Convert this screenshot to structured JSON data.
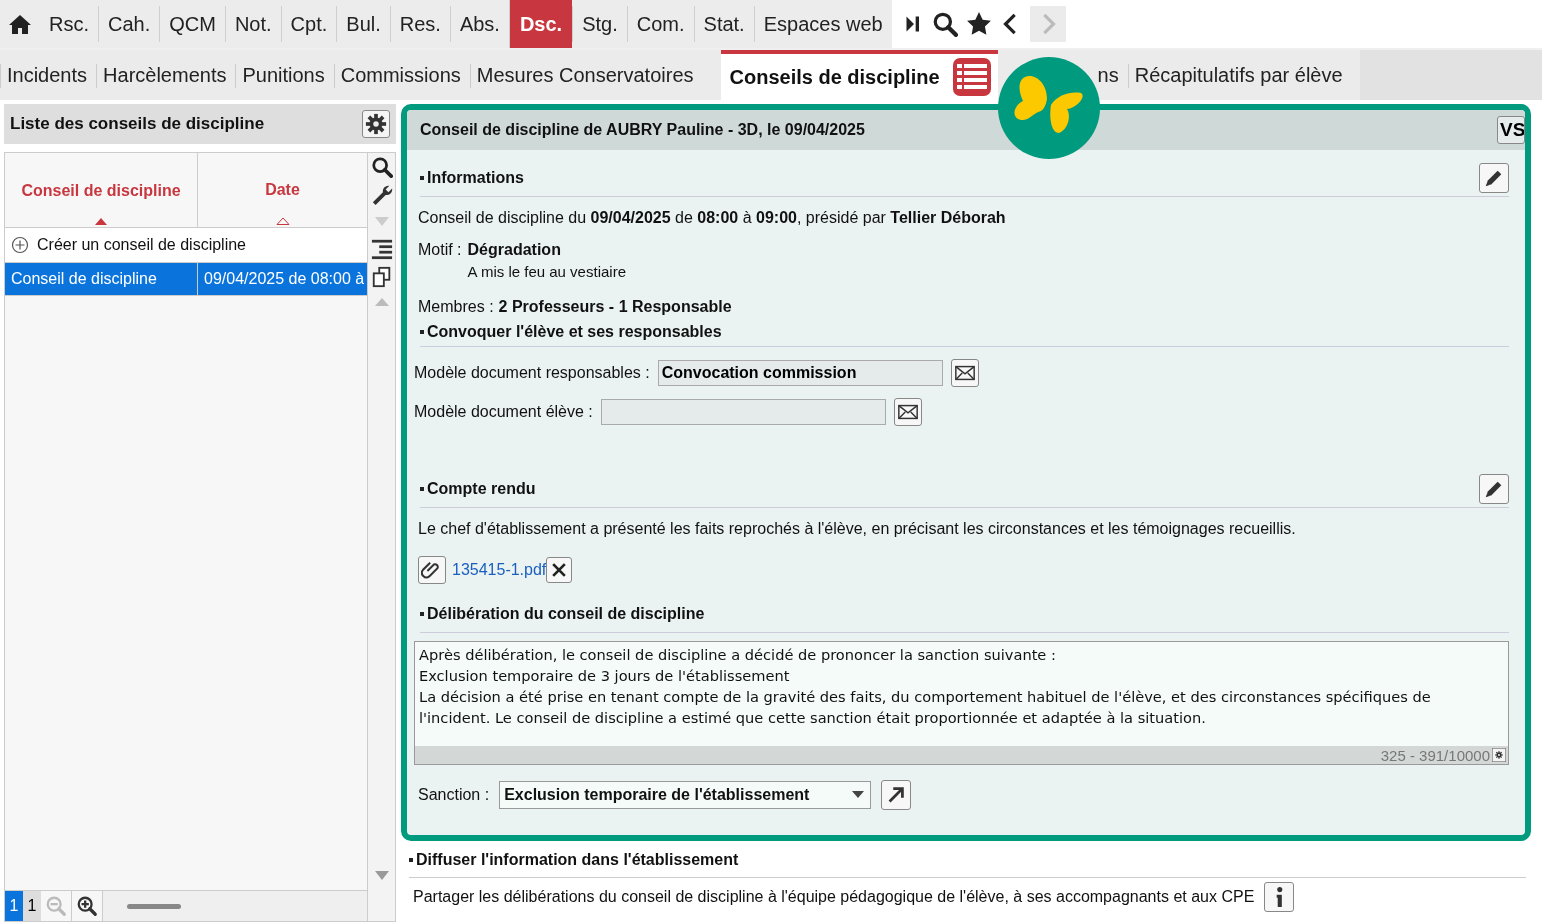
{
  "topnav": {
    "items": [
      {
        "label": "Rsc.",
        "selected": false
      },
      {
        "label": "Cah.",
        "selected": false
      },
      {
        "label": "QCM",
        "selected": false
      },
      {
        "label": "Not.",
        "selected": false
      },
      {
        "label": "Cpt.",
        "selected": false
      },
      {
        "label": "Bul.",
        "selected": false
      },
      {
        "label": "Res.",
        "selected": false
      },
      {
        "label": "Abs.",
        "selected": false
      },
      {
        "label": "Dsc.",
        "selected": true
      },
      {
        "label": "Stg.",
        "selected": false
      },
      {
        "label": "Com.",
        "selected": false
      },
      {
        "label": "Stat.",
        "selected": false
      },
      {
        "label": "Espaces web",
        "selected": false
      }
    ]
  },
  "subtabs": {
    "items": [
      {
        "label": "Incidents",
        "selected": false
      },
      {
        "label": "Harcèlements",
        "selected": false
      },
      {
        "label": "Punitions",
        "selected": false
      },
      {
        "label": "Commissions",
        "selected": false
      },
      {
        "label": "Mesures Conservatoires",
        "selected": false
      },
      {
        "label": "Conseils de discipline",
        "selected": true
      },
      {
        "label": "ns",
        "selected": false
      },
      {
        "label": "Récapitulatifs par élève",
        "selected": false
      }
    ]
  },
  "list": {
    "title": "Liste des conseils de discipline",
    "columns": [
      {
        "label": "Conseil de discipline",
        "sorted": true
      },
      {
        "label": "Date",
        "sorted": false
      }
    ],
    "create_label": "Créer un conseil de discipline",
    "rows": [
      {
        "cells": [
          "Conseil de discipline",
          "09/04/2025 de 08:00 à"
        ],
        "selected": true
      }
    ],
    "pager": [
      "1",
      "1"
    ]
  },
  "detail": {
    "title": "Conseil de discipline de AUBRY Pauline - 3D, le 09/04/2025",
    "badge": "VS",
    "info_heading": "Informations",
    "info_sentence": "Conseil de discipline du **09/04/2025** de **08:00** à **09:00**, présidé par **Tellier Déborah**",
    "motif_label": "Motif :",
    "motif": "Dégradation",
    "motif_detail": "A mis le feu au vestiaire",
    "members_label": "Membres :",
    "members": "2 Professeurs - 1 Responsable",
    "convoke_heading": "Convoquer l'élève et ses responsables",
    "fields": [
      {
        "label": "Modèle document responsables :",
        "value": "Convocation commission"
      },
      {
        "label": "Modèle document élève :"
      }
    ],
    "report_heading": "Compte rendu",
    "report_text": "Le chef d'établissement a présenté les faits reprochés à l'élève, en précisant les circonstances et les témoignages recueillis.",
    "attachment": "135415-1.pdf",
    "deliberation_heading": "Délibération du conseil de discipline",
    "deliberation_text": "Après délibération, le conseil de discipline a décidé de prononcer la sanction suivante :\nExclusion temporaire de 3 jours de l'établissement\nLa décision a été prise en tenant compte de la gravité des faits, du comportement habituel de l'élève, et des circonstances spécifiques de l'incident. Le conseil de discipline a estimé que cette sanction était proportionnée et adaptée à la situation.",
    "counter": "325 - 391/10000",
    "sanction_label": "Sanction :",
    "sanction": "Exclusion temporaire de l'établissement"
  },
  "diffuse": {
    "heading": "Diffuser l'information dans l'établissement",
    "text": "Partager les délibérations du conseil de discipline à l'équipe pédagogique de l'élève, à ses accompagnants et aux CPE"
  }
}
